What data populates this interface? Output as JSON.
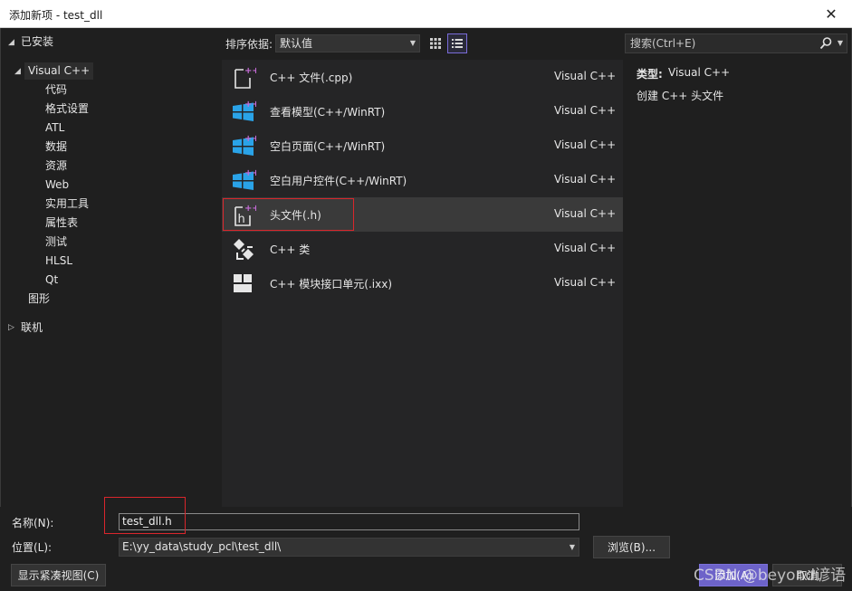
{
  "window": {
    "title": "添加新项 - test_dll",
    "close_glyph": "✕"
  },
  "tree": {
    "installed": "已安装",
    "visual_cpp": "Visual C++",
    "children": [
      "代码",
      "格式设置",
      "ATL",
      "数据",
      "资源",
      "Web",
      "实用工具",
      "属性表",
      "测试",
      "HLSL",
      "Qt"
    ],
    "graphics": "图形",
    "online": "联机"
  },
  "toolbar": {
    "sort_label": "排序依据:",
    "sort_value": "默认值",
    "grid_view_icon": "grid-view-icon",
    "list_view_icon": "list-view-icon"
  },
  "search": {
    "placeholder": "搜索(Ctrl+E)",
    "icon": "search-icon"
  },
  "templates": [
    {
      "name": "C++ 文件(.cpp)",
      "lang": "Visual C++",
      "icon": "cpp-file-icon"
    },
    {
      "name": "查看模型(C++/WinRT)",
      "lang": "Visual C++",
      "icon": "windows-icon"
    },
    {
      "name": "空白页面(C++/WinRT)",
      "lang": "Visual C++",
      "icon": "windows-icon"
    },
    {
      "name": "空白用户控件(C++/WinRT)",
      "lang": "Visual C++",
      "icon": "windows-icon"
    },
    {
      "name": "头文件(.h)",
      "lang": "Visual C++",
      "icon": "header-file-icon",
      "selected": true
    },
    {
      "name": "C++ 类",
      "lang": "Visual C++",
      "icon": "cpp-class-icon"
    },
    {
      "name": "C++ 模块接口单元(.ixx)",
      "lang": "Visual C++",
      "icon": "module-icon"
    }
  ],
  "details": {
    "type_label": "类型:",
    "type_value": "Visual C++",
    "description": "创建 C++ 头文件"
  },
  "form": {
    "name_label": "名称(N):",
    "name_value": "test_dll.h",
    "location_label": "位置(L):",
    "location_value": "E:\\yy_data\\study_pcl\\test_dll\\",
    "browse": "浏览(B)...",
    "compact_view": "显示紧凑视图(C)",
    "add": "添加(A)",
    "cancel": "取消"
  },
  "watermark": "CSDN @beyond谚语",
  "colors": {
    "accent": "#6d63c9",
    "highlight_box": "#d9262c",
    "windows_blue": "#2aa3e8",
    "plus_magenta": "#c46bd6"
  }
}
